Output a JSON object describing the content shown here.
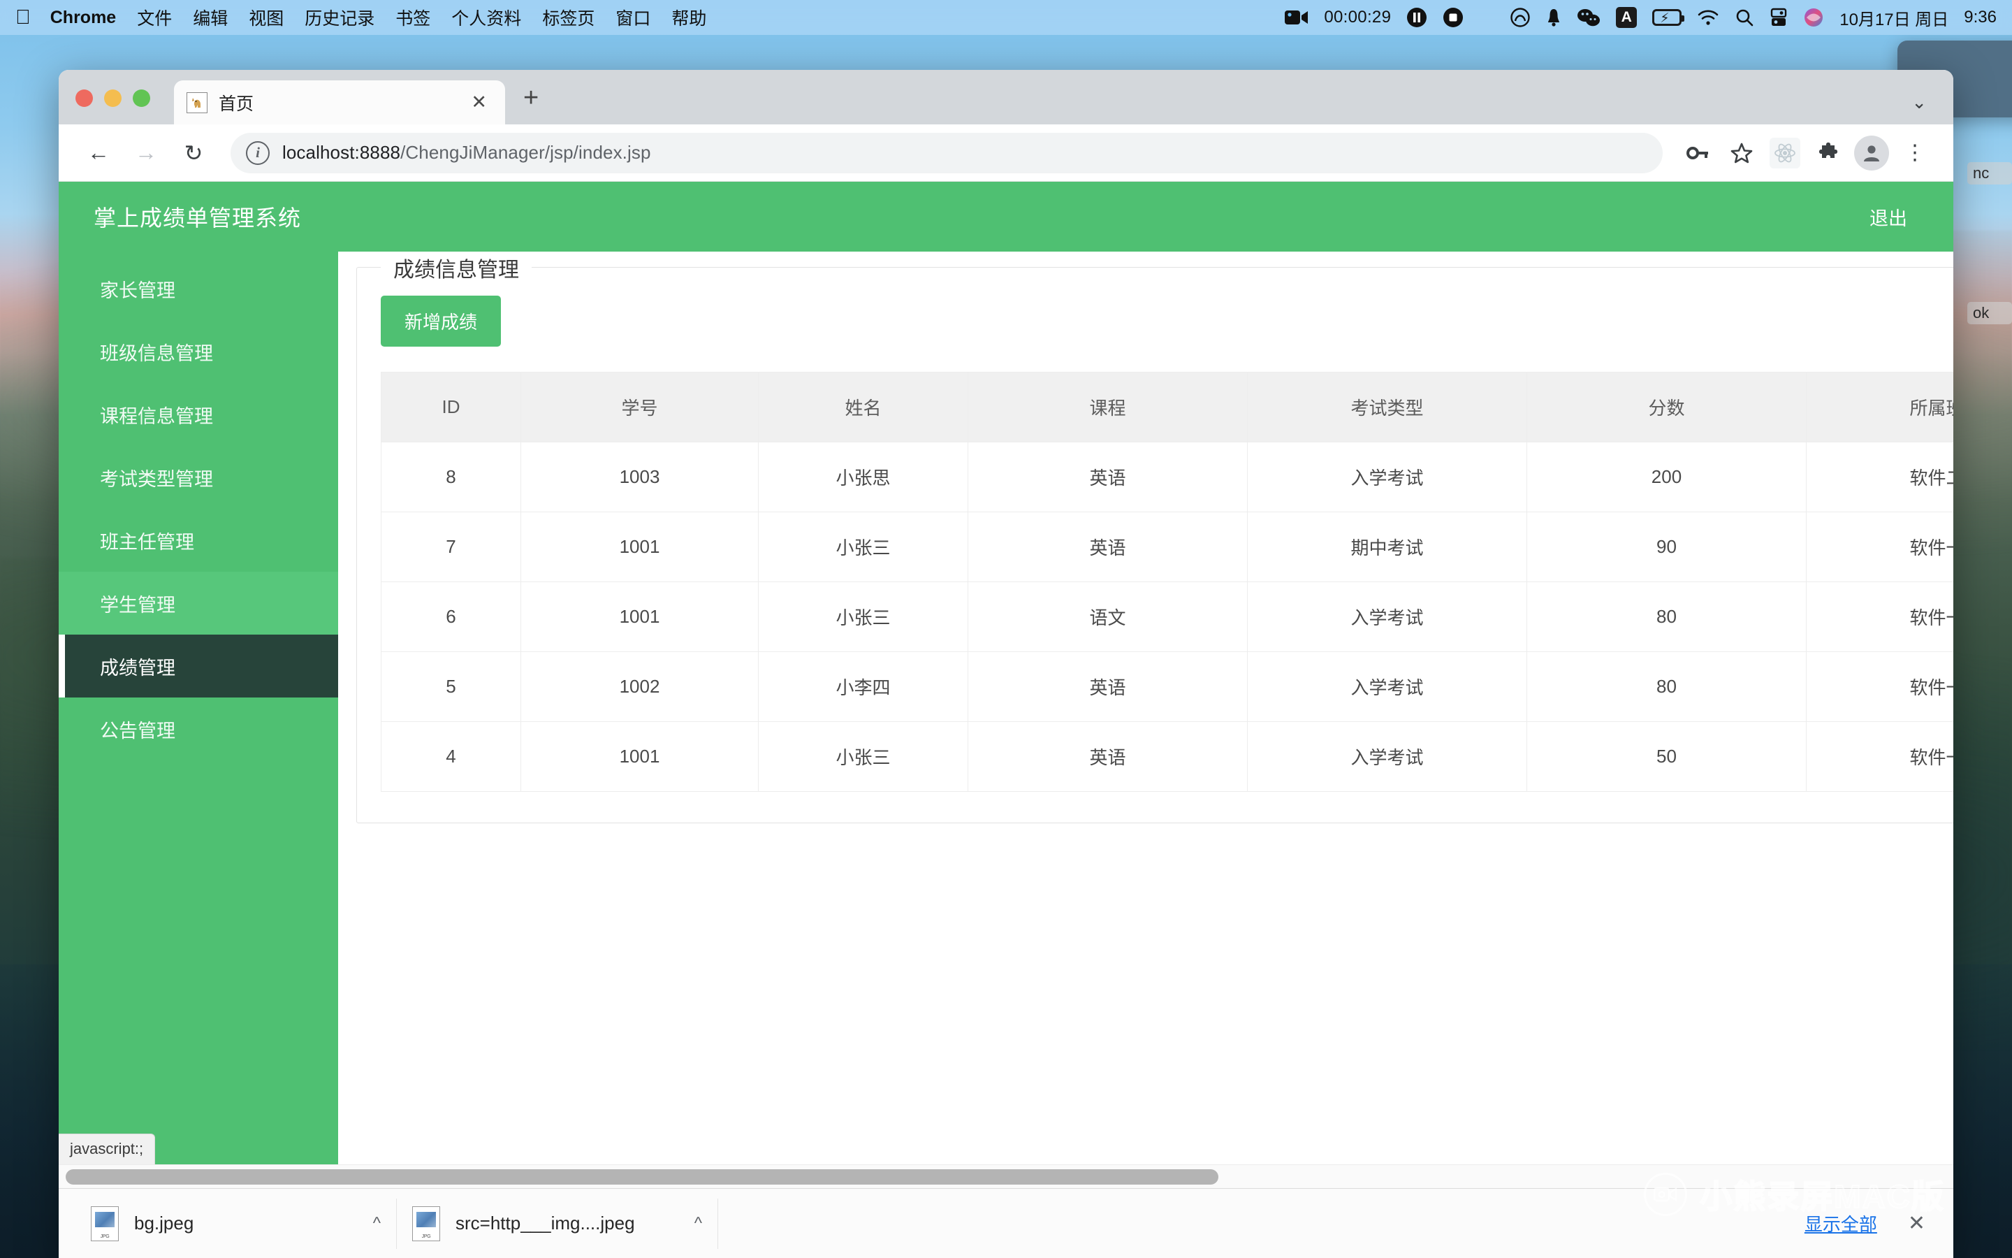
{
  "menubar": {
    "apple_icon": "apple-icon",
    "items": [
      "Chrome",
      "文件",
      "编辑",
      "视图",
      "历史记录",
      "书签",
      "个人资料",
      "标签页",
      "窗口",
      "帮助"
    ],
    "recording": {
      "camera_icon": "video-camera-icon",
      "timer": "00:00:29",
      "pause_icon": "pause-icon",
      "stop_icon": "stop-icon"
    },
    "status_icons": [
      "creative-cloud-icon",
      "bell-icon",
      "wechat-icon",
      "input-method-A-icon",
      "battery-charging-icon",
      "wifi-icon",
      "search-icon",
      "control-center-icon",
      "siri-icon"
    ],
    "date": "10月17日 周日",
    "time": "9:36"
  },
  "desktop": {
    "labels": [
      "nc",
      "ok"
    ]
  },
  "browser": {
    "tab": {
      "favicon": "tomcat-cat-icon",
      "title": "首页",
      "close_icon": "close-icon"
    },
    "new_tab_icon": "plus-icon",
    "tab_search_icon": "chevron-down-icon",
    "nav": {
      "back_icon": "arrow-left-icon",
      "forward_icon": "arrow-right-icon",
      "reload_icon": "reload-icon"
    },
    "omnibox": {
      "info_icon": "info-circle-icon",
      "url_scheme_host": "localhost:8888",
      "url_path": "/ChengJiManager/jsp/index.jsp",
      "url_full": "localhost:8888/ChengJiManager/jsp/index.jsp"
    },
    "toolbar_icons": [
      "key-icon",
      "star-icon",
      "react-devtools-icon",
      "extensions-puzzle-icon",
      "profile-avatar-icon",
      "three-dot-menu-icon"
    ],
    "status_bubble": "javascript:;",
    "downloads": {
      "items": [
        {
          "name": "bg.jpeg",
          "file_icon": "jpeg-file-icon",
          "caret_icon": "chevron-up-icon"
        },
        {
          "name": "src=http___img....jpeg",
          "file_icon": "jpeg-file-icon",
          "caret_icon": "chevron-up-icon"
        }
      ],
      "show_all_label": "显示全部",
      "close_icon": "close-icon"
    }
  },
  "app": {
    "title": "掌上成绩单管理系统",
    "logout_label": "退出",
    "accent_color": "#4fc072",
    "active_nav_color": "#27443a",
    "sidebar": {
      "items": [
        {
          "label": "家长管理",
          "state": "normal"
        },
        {
          "label": "班级信息管理",
          "state": "normal"
        },
        {
          "label": "课程信息管理",
          "state": "normal"
        },
        {
          "label": "考试类型管理",
          "state": "normal"
        },
        {
          "label": "班主任管理",
          "state": "normal"
        },
        {
          "label": "学生管理",
          "state": "hover"
        },
        {
          "label": "成绩管理",
          "state": "active"
        },
        {
          "label": "公告管理",
          "state": "normal"
        }
      ]
    },
    "panel": {
      "legend": "成绩信息管理",
      "add_button": "新增成绩",
      "table": {
        "columns": [
          "ID",
          "学号",
          "姓名",
          "课程",
          "考试类型",
          "分数",
          "所属班级"
        ],
        "rows": [
          [
            "8",
            "1003",
            "小张思",
            "英语",
            "入学考试",
            "200",
            "软件二班"
          ],
          [
            "7",
            "1001",
            "小张三",
            "英语",
            "期中考试",
            "90",
            "软件一班"
          ],
          [
            "6",
            "1001",
            "小张三",
            "语文",
            "入学考试",
            "80",
            "软件一班"
          ],
          [
            "5",
            "1002",
            "小李四",
            "英语",
            "入学考试",
            "80",
            "软件一班"
          ],
          [
            "4",
            "1001",
            "小张三",
            "英语",
            "入学考试",
            "50",
            "软件一班"
          ]
        ]
      }
    }
  },
  "watermark": {
    "logo_icon": "bear-recorder-camera-icon",
    "text": "小熊录屏MAC版"
  }
}
